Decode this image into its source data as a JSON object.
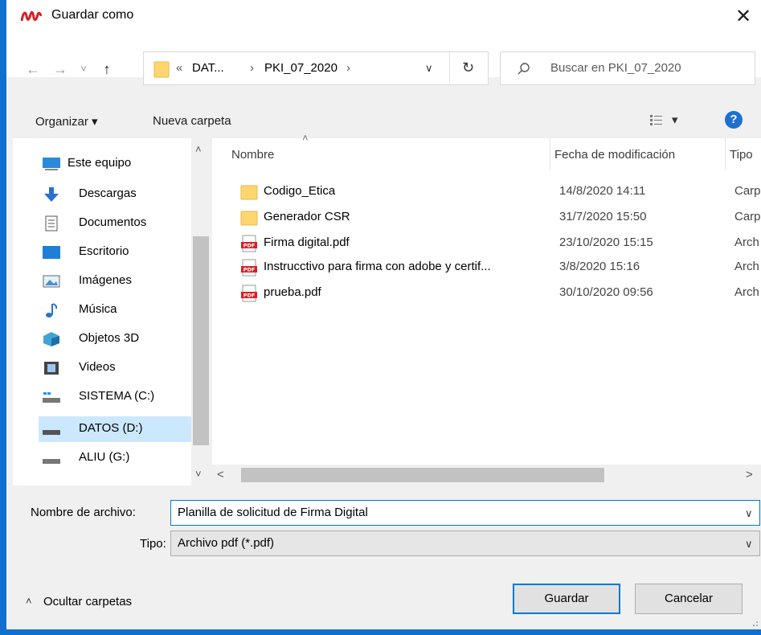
{
  "window": {
    "title": "Guardar como",
    "close_glyph": "✕"
  },
  "nav": {
    "back_glyph": "←",
    "forward_glyph": "→",
    "recent_glyph": "˅",
    "up_glyph": "↑",
    "address": {
      "overflow": "«",
      "segments": [
        "DAT...",
        "PKI_07_2020"
      ],
      "separator": "›"
    },
    "dropdown_glyph": "∨",
    "refresh_glyph": "↻",
    "search_placeholder": "Buscar en PKI_07_2020"
  },
  "toolbar": {
    "organize_label": "Organizar ▾",
    "new_folder_label": "Nueva carpeta",
    "view_caret": "▾",
    "help_glyph": "?"
  },
  "sidebar": {
    "items": [
      {
        "label": "Este equipo",
        "icon": "computer-icon"
      },
      {
        "label": "Descargas",
        "icon": "downloads-icon"
      },
      {
        "label": "Documentos",
        "icon": "documents-icon"
      },
      {
        "label": "Escritorio",
        "icon": "desktop-icon"
      },
      {
        "label": "Imágenes",
        "icon": "pictures-icon"
      },
      {
        "label": "Música",
        "icon": "music-icon"
      },
      {
        "label": "Objetos 3D",
        "icon": "objects3d-icon"
      },
      {
        "label": "Videos",
        "icon": "videos-icon"
      },
      {
        "label": "SISTEMA (C:)",
        "icon": "system-drive-icon"
      },
      {
        "label": "DATOS (D:)",
        "icon": "drive-icon",
        "selected": true
      },
      {
        "label": "ALIU (G:)",
        "icon": "drive-icon"
      }
    ],
    "scroll_up": "˄",
    "scroll_down": "˅"
  },
  "files": {
    "columns": [
      "Nombre",
      "Fecha de modificación",
      "Tipo"
    ],
    "sort_glyph": "˄",
    "rows": [
      {
        "name": "Codigo_Etica",
        "date": "14/8/2020 14:11",
        "type": "Carp",
        "icon": "folder-icon"
      },
      {
        "name": "Generador CSR",
        "date": "31/7/2020 15:50",
        "type": "Carp",
        "icon": "folder-icon"
      },
      {
        "name": "Firma digital.pdf",
        "date": "23/10/2020 15:15",
        "type": "Arch",
        "icon": "pdf-icon"
      },
      {
        "name": "Instrucctivo para firma con adobe y certif...",
        "date": "3/8/2020 15:16",
        "type": "Arch",
        "icon": "pdf-icon"
      },
      {
        "name": "prueba.pdf",
        "date": "30/10/2020 09:56",
        "type": "Arch",
        "icon": "pdf-icon"
      }
    ],
    "pdf_badge": "PDF",
    "scroll_left": "<",
    "scroll_right": ">"
  },
  "form": {
    "filename_label": "Nombre de archivo:",
    "filename_value": "Planilla de solicitud de Firma Digital",
    "type_label": "Tipo:",
    "type_value": "Archivo pdf (*.pdf)",
    "combo_glyph": "∨"
  },
  "footer": {
    "hide_folders_glyph": "˄",
    "hide_folders_label": "Ocultar carpetas",
    "save_label": "Guardar",
    "cancel_label": "Cancelar"
  },
  "colors": {
    "accent": "#0078d7",
    "titlebar_bg": "#ffffff",
    "dialog_bg": "#f0f0f0",
    "selection_bg": "#cce8ff",
    "folder": "#ffd66e",
    "pdf": "#d81f26"
  }
}
